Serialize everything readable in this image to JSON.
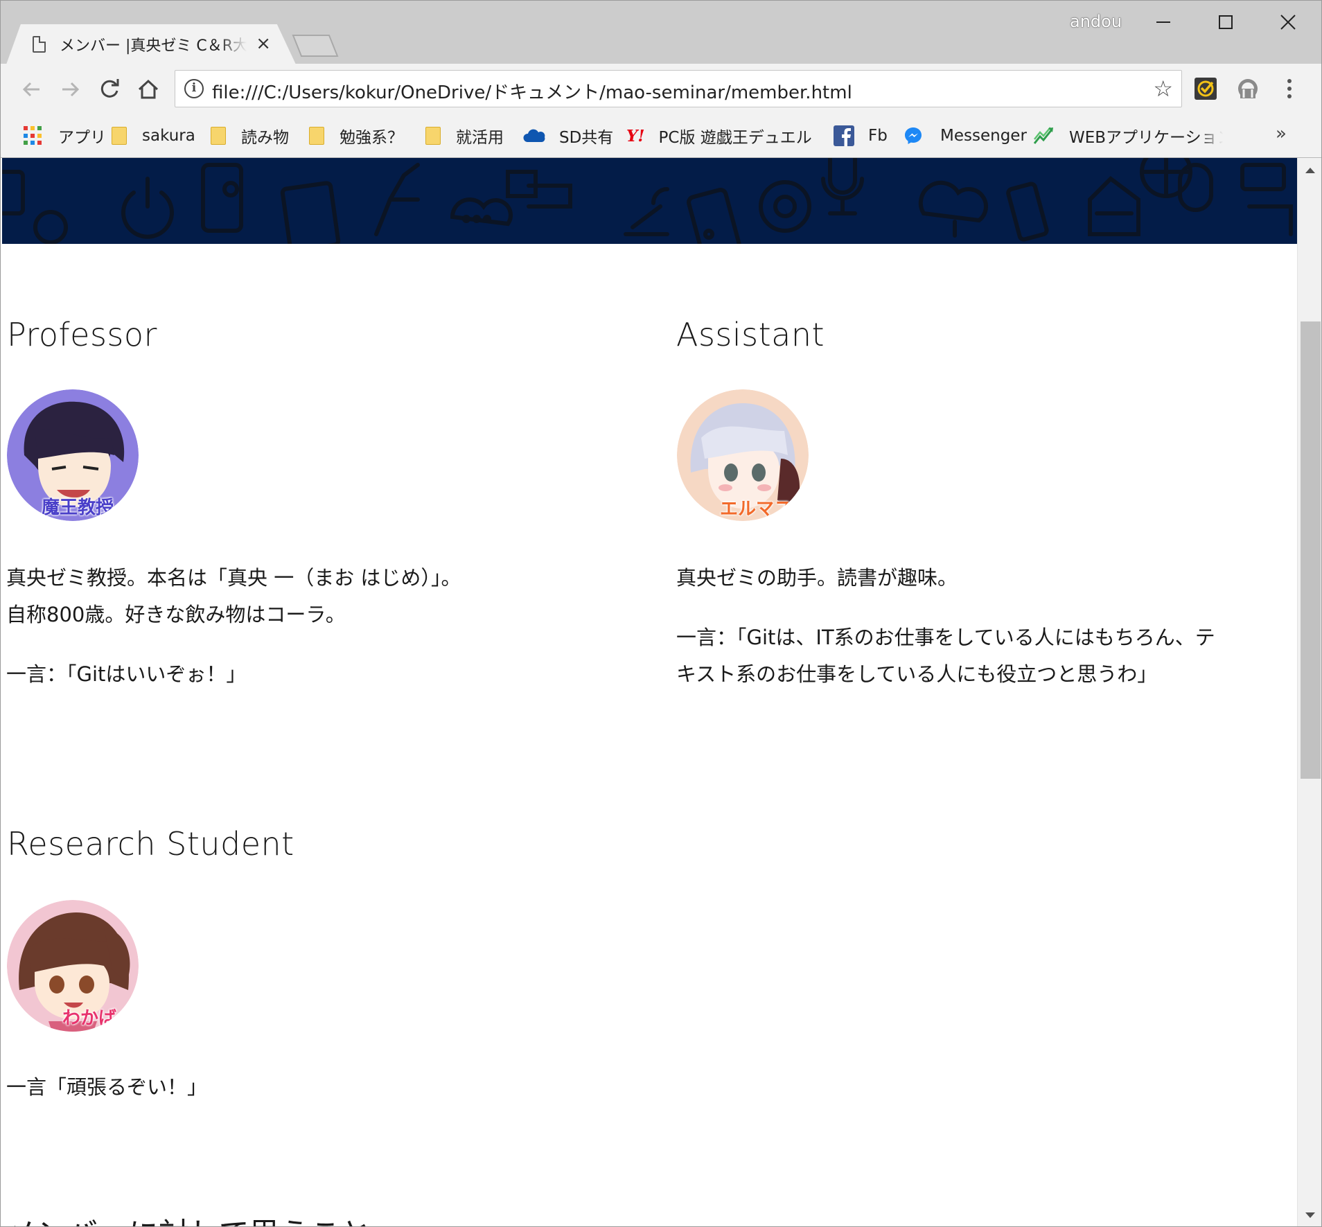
{
  "browser": {
    "tab_title": "メンバー |真央ゼミ C＆R大学",
    "profile_name": "andou",
    "url": "file:///C:/Users/kokur/OneDrive/ドキュメント/mao-seminar/member.html"
  },
  "bookmarks": [
    {
      "label": "アプリ",
      "icon": "apps-grid-icon"
    },
    {
      "label": "sakura",
      "icon": "folder-icon"
    },
    {
      "label": "読み物",
      "icon": "folder-icon"
    },
    {
      "label": "勉強系？",
      "icon": "folder-icon"
    },
    {
      "label": "就活用",
      "icon": "folder-icon"
    },
    {
      "label": "SD共有",
      "icon": "onedrive-cloud-icon"
    },
    {
      "label": "PC版 遊戯王デュエルリ",
      "icon": "yahoo-icon"
    },
    {
      "label": "Fb",
      "icon": "facebook-icon"
    },
    {
      "label": "Messenger",
      "icon": "messenger-icon"
    },
    {
      "label": "WEBアプリケーションエキ",
      "icon": "chart-arrow-icon"
    }
  ],
  "sections": {
    "professor": {
      "heading": "Professor",
      "avatar_label": "魔王教授",
      "lines": [
        "真央ゼミ教授。本名は「真央 一（まお はじめ）」。",
        "自称800歳。好きな飲み物はコーラ。"
      ],
      "quote": "一言：「Gitはいいぞぉ！」"
    },
    "assistant": {
      "heading": "Assistant",
      "avatar_label": "エルマス",
      "lines": [
        "真央ゼミの助手。読書が趣味。"
      ],
      "quote": [
        "一言：「Gitは、IT系のお仕事をしている人にはもちろん、テ",
        "キスト系のお仕事をしている人にも役立つと思うわ」"
      ]
    },
    "student": {
      "heading": "Research Student",
      "avatar_label": "わかば",
      "quote": "一言「頑張るぞい！」"
    },
    "next_heading": "メンバーに対して思うこと"
  },
  "colors": {
    "banner": "#031c48",
    "professor_avatar_bg": "#8c7fe0",
    "assistant_avatar_bg": "#f6d8c4",
    "student_avatar_bg": "#f2c6d2",
    "professor_label": "#4a3fc9",
    "assistant_label": "#f26a2a",
    "student_label": "#e8336d"
  }
}
